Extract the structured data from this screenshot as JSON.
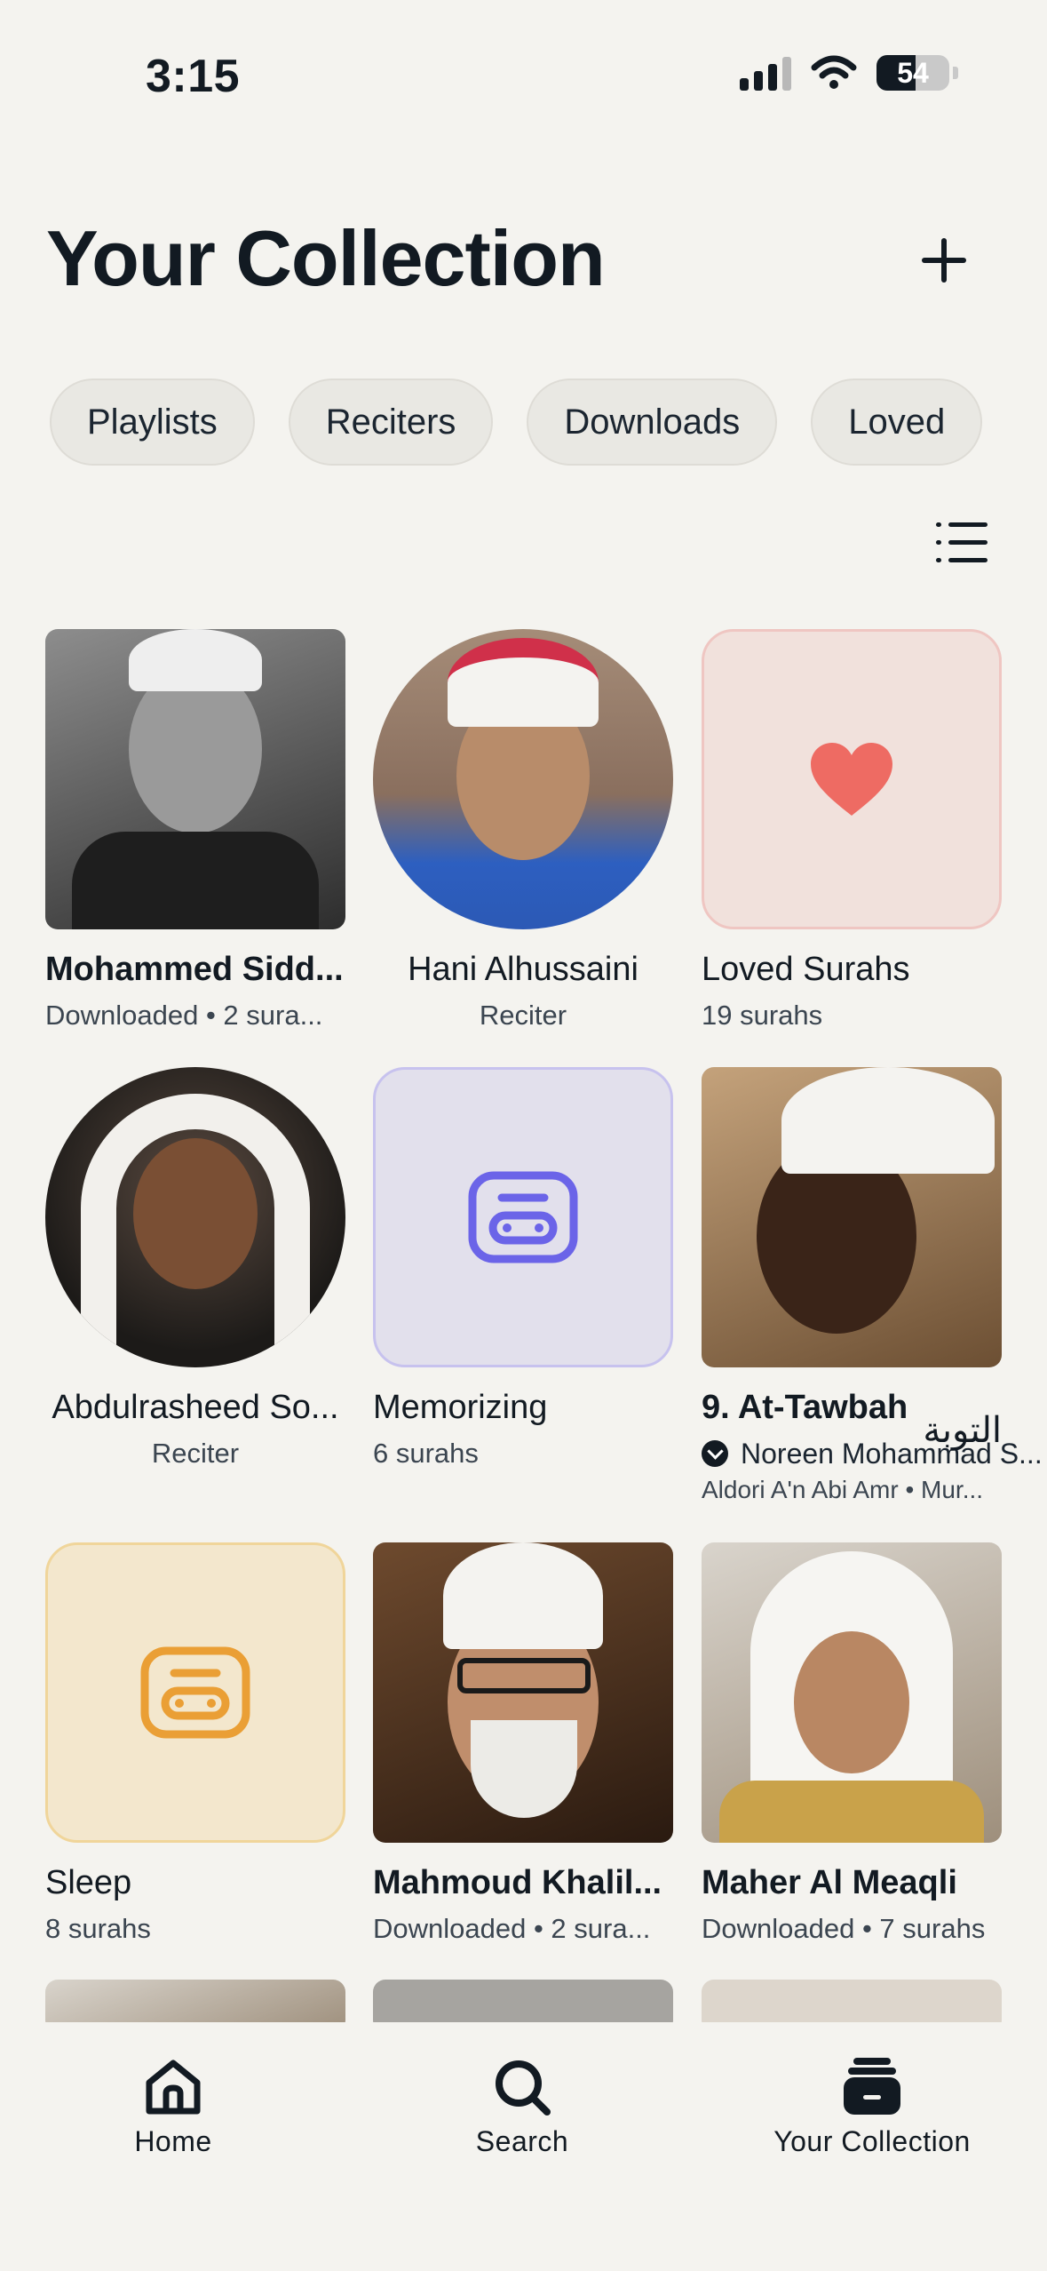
{
  "status_bar": {
    "time": "3:15",
    "battery": "54"
  },
  "header": {
    "title": "Your Collection"
  },
  "filters": [
    "Playlists",
    "Reciters",
    "Downloads",
    "Loved"
  ],
  "grid": {
    "r1": [
      {
        "title": "Mohammed Sidd...",
        "subtitle": "Downloaded • 2 sura..."
      },
      {
        "title": "Hani Alhussaini",
        "subtitle": "Reciter"
      },
      {
        "title": "Loved Surahs",
        "subtitle": "19 surahs"
      }
    ],
    "r2": [
      {
        "title": "Abdulrasheed So...",
        "subtitle": "Reciter"
      },
      {
        "title": "Memorizing",
        "subtitle": "6 surahs"
      },
      {
        "title": "9. At-Tawbah",
        "arabic": "التوبة",
        "subtitle": "Noreen Mohammad S...",
        "subtitle2": "Aldori A'n Abi Amr • Mur..."
      }
    ],
    "r3": [
      {
        "title": "Sleep",
        "subtitle": "8 surahs"
      },
      {
        "title": "Mahmoud Khalil...",
        "subtitle": "Downloaded • 2 sura..."
      },
      {
        "title": "Maher Al Meaqli",
        "subtitle": "Downloaded • 7 surahs"
      }
    ]
  },
  "colors": {
    "loved": "#ee6b63",
    "memorizing": "#6b64e8",
    "sleep": "#ea9f35"
  },
  "tab_bar": {
    "home": "Home",
    "search": "Search",
    "collection": "Your Collection"
  }
}
